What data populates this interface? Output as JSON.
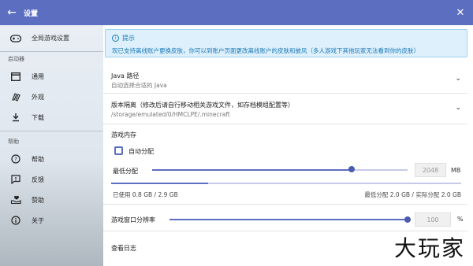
{
  "window": {
    "title": "设置"
  },
  "sidebar": {
    "global": "全局游戏设置",
    "section_launcher": "启动器",
    "launcher_items": [
      {
        "label": "通用",
        "icon": "window-icon"
      },
      {
        "label": "外观",
        "icon": "palette-icon"
      },
      {
        "label": "下载",
        "icon": "download-icon"
      }
    ],
    "section_help": "帮助",
    "help_items": [
      {
        "label": "帮助",
        "icon": "help-circle-icon"
      },
      {
        "label": "反馈",
        "icon": "feedback-icon"
      },
      {
        "label": "赞助",
        "icon": "donate-icon"
      },
      {
        "label": "关于",
        "icon": "info-icon"
      }
    ]
  },
  "notice": {
    "title": "提示",
    "body": "现已支持离线账户更换皮肤，你可以到账户页面更改离线账户的皮肤和披风（多人游戏下其他玩家无法看到你的皮肤）"
  },
  "java": {
    "title": "Java 路径",
    "subtitle": "自动选择合适的 Java"
  },
  "isolation": {
    "title": "版本隔离（修改后请自行移动相关游戏文件，如存档模组配置等）",
    "subtitle": "/storage/emulated/0/HMCLPE/.minecraft"
  },
  "memory": {
    "title": "游戏内存",
    "auto_label": "自动分配",
    "min_label": "最低分配",
    "value": "2048",
    "unit": "MB",
    "slider_fraction": 0.78,
    "used_text": "已使用 0.8 GB / 2.9 GB",
    "used_fraction": 0.276,
    "alloc_text": "最低分配 2.0 GB / 实际分配 2.0 GB"
  },
  "resolution": {
    "label": "游戏窗口分辨率",
    "value": "100",
    "unit": "%",
    "slider_fraction": 1.0
  },
  "log": {
    "label": "查看日志"
  },
  "watermark": "大玩家",
  "colors": {
    "primary": "#5c6ec0",
    "notice_bg": "#ddf0fb",
    "notice_text": "#1a78b8"
  }
}
